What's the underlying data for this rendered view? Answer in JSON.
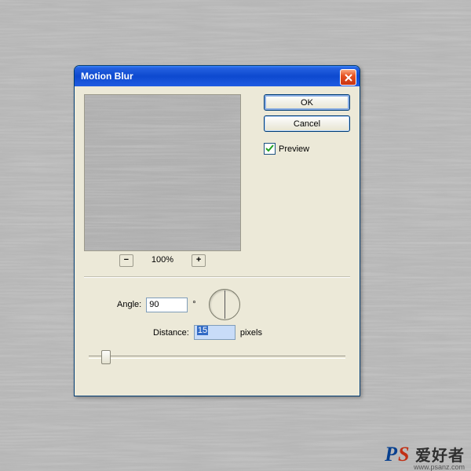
{
  "dialog": {
    "title": "Motion Blur",
    "ok_label": "OK",
    "cancel_label": "Cancel",
    "preview_label": "Preview",
    "preview_checked": true,
    "zoom_value": "100%",
    "angle_label": "Angle:",
    "angle_value": "90",
    "angle_unit": "°",
    "distance_label": "Distance:",
    "distance_value": "15",
    "distance_unit": "pixels"
  },
  "watermark": {
    "brand_chinese": "爱好者",
    "url": "www.psanz.com"
  }
}
